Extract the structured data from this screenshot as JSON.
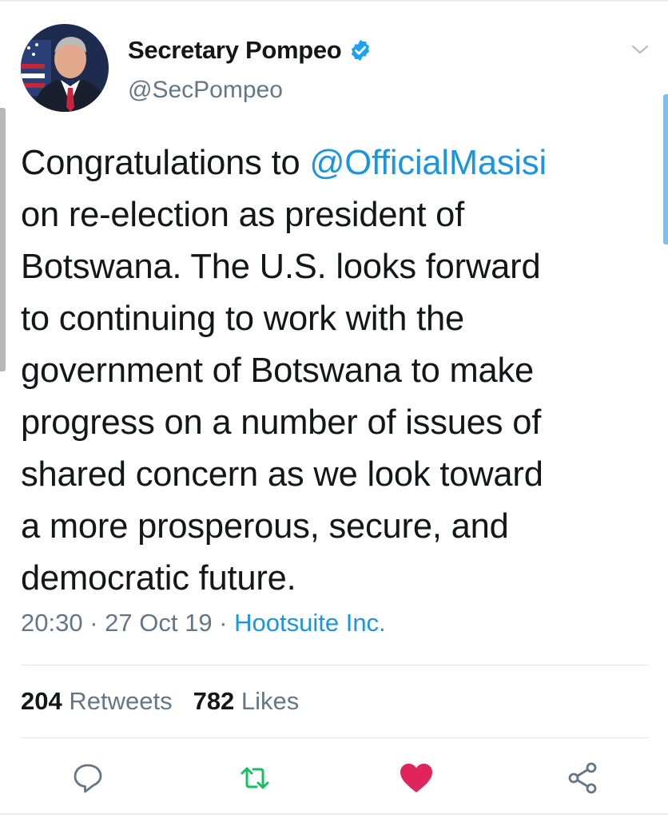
{
  "tweet": {
    "author": {
      "display_name": "Secretary Pompeo",
      "handle": "@SecPompeo",
      "verified": true
    },
    "text": {
      "line1_before": "Congratulations to ",
      "mention": "@OfficialMasisi",
      "line2": "on re-election as president of",
      "line3": "Botswana. The U.S. looks forward",
      "line4": "to continuing to work with the",
      "line5": "government of Botswana to make",
      "line6": "progress on a number of issues of",
      "line7": "shared concern as we look toward",
      "line8": "a more prosperous, secure, and",
      "line9": "democratic future."
    },
    "meta": {
      "time": "20:30",
      "separator": " · ",
      "date": "27 Oct 19",
      "source": "Hootsuite Inc."
    },
    "stats": {
      "retweets_count": "204",
      "retweets_label": " Retweets",
      "likes_count": "782",
      "likes_label": " Likes"
    },
    "actions": {
      "liked": true,
      "retweeted": false
    }
  },
  "icons": {
    "verified": "verified-badge-icon",
    "menu": "chevron-down-icon",
    "reply": "reply-icon",
    "retweet": "retweet-icon",
    "like": "heart-icon",
    "share": "share-icon"
  },
  "colors": {
    "text": "#14171a",
    "secondary": "#657786",
    "link": "#1b95e0",
    "verified": "#1da1f2",
    "retweet": "#17bf63",
    "like": "#e0245e",
    "divider": "#e1e8ed"
  }
}
